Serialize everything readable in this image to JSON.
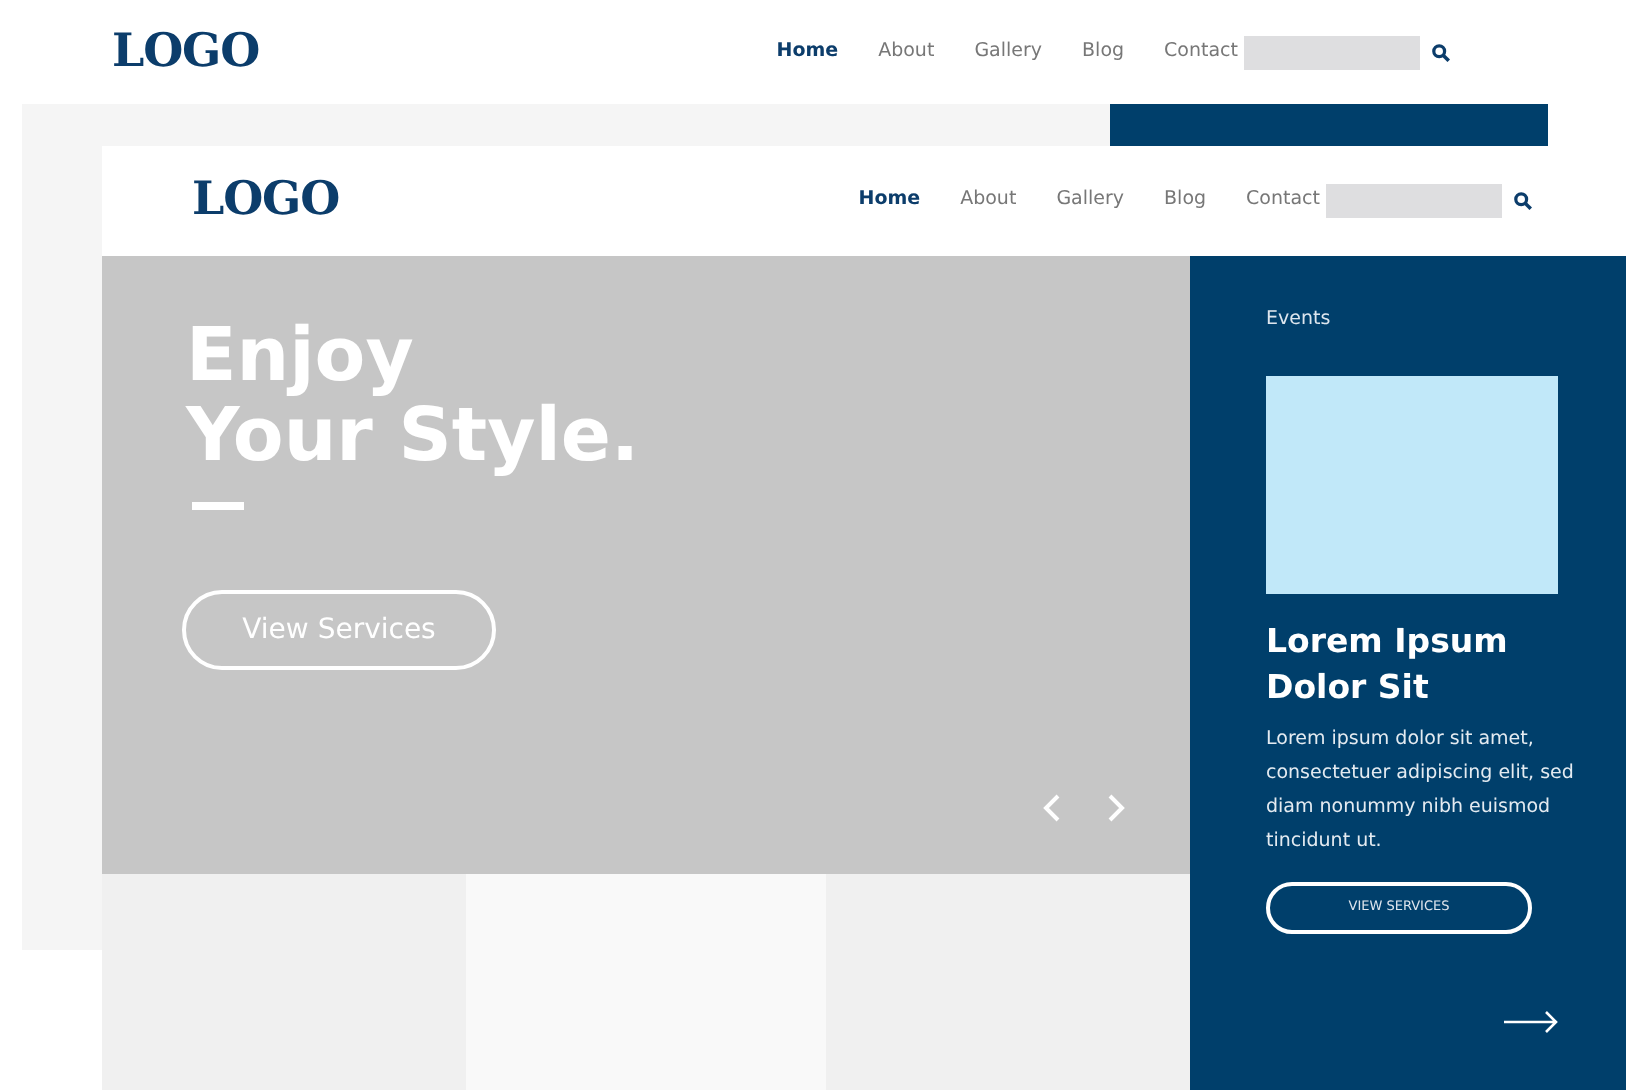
{
  "headers": [
    {
      "logo": "LOGO",
      "nav": [
        {
          "label": "Home",
          "selected": true
        },
        {
          "label": "About",
          "selected": false
        },
        {
          "label": "Gallery",
          "selected": false
        },
        {
          "label": "Blog",
          "selected": false
        },
        {
          "label": "Contact",
          "selected": false
        }
      ]
    },
    {
      "logo": "LOGO",
      "nav": [
        {
          "label": "Home",
          "selected": true
        },
        {
          "label": "About",
          "selected": false
        },
        {
          "label": "Gallery",
          "selected": false
        },
        {
          "label": "Blog",
          "selected": false
        },
        {
          "label": "Contact",
          "selected": false
        }
      ]
    }
  ],
  "hero": {
    "title_lines": [
      "Enjoy",
      "Your Style."
    ],
    "button": "View Services"
  },
  "events": {
    "label": "Events",
    "heading": "Lorem Ipsum Dolor Sit",
    "body": "Lorem ipsum dolor sit amet, consectetuer adipiscing elit, sed diam nonummy nibh euismod tincidunt ut.",
    "button": "VIEW SERVICES"
  }
}
